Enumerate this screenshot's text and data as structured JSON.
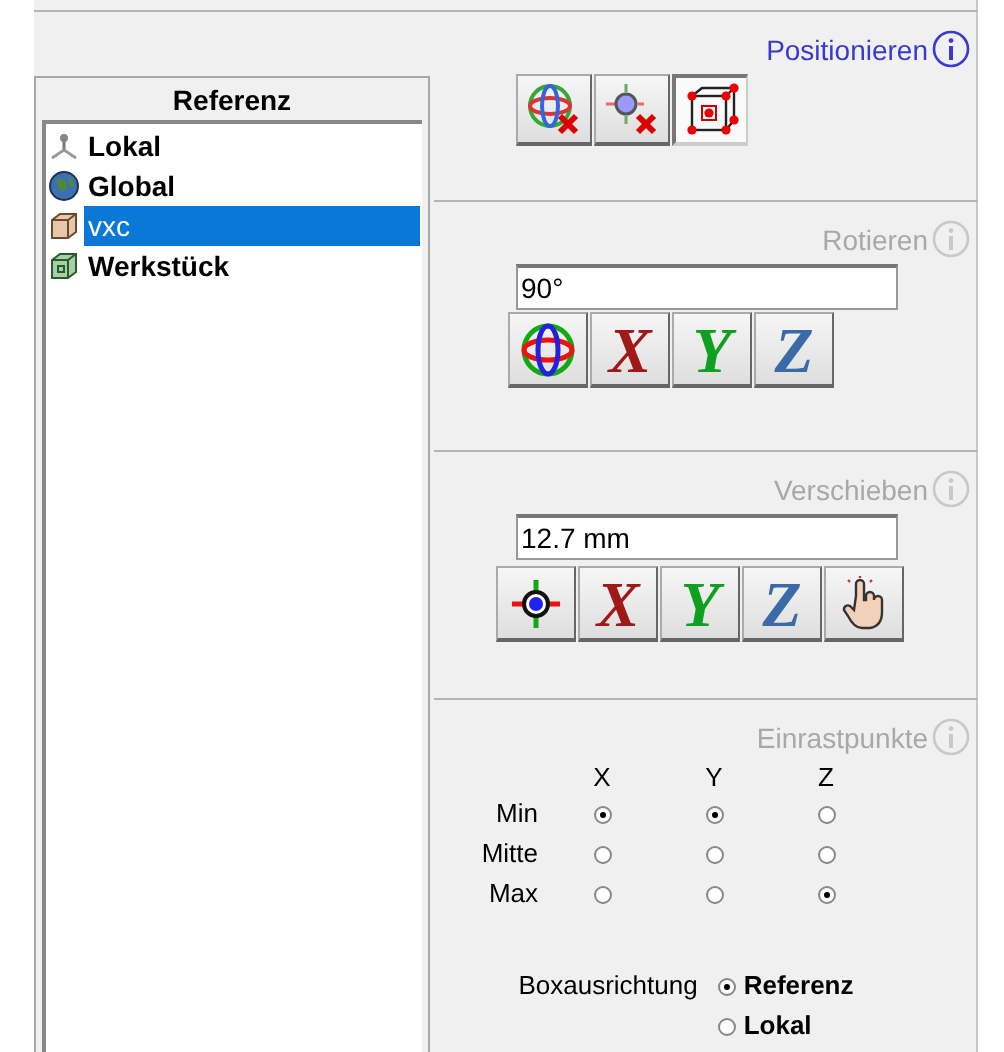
{
  "reference": {
    "title": "Referenz",
    "items": [
      {
        "label": "Lokal",
        "kind": "axes",
        "selected": false
      },
      {
        "label": "Global",
        "kind": "globe",
        "selected": false
      },
      {
        "label": "vxc",
        "kind": "box-tan",
        "selected": true
      },
      {
        "label": "Werkstück",
        "kind": "box-green",
        "selected": false
      }
    ]
  },
  "positioning": {
    "title": "Positionieren",
    "active": true,
    "buttons": [
      {
        "kind": "globe-remove",
        "selected": false
      },
      {
        "kind": "point-remove",
        "selected": false
      },
      {
        "kind": "bounding-box",
        "selected": true
      }
    ]
  },
  "rotate": {
    "title": "Rotieren",
    "active": false,
    "value": "90°",
    "buttons": [
      {
        "kind": "globe"
      },
      {
        "kind": "letter",
        "label": "X",
        "color": "#a01818"
      },
      {
        "kind": "letter",
        "label": "Y",
        "color": "#10a020"
      },
      {
        "kind": "letter",
        "label": "Z",
        "color": "#3a6aa8"
      }
    ]
  },
  "move": {
    "title": "Verschieben",
    "active": false,
    "value": "12.7 mm",
    "buttons": [
      {
        "kind": "crosshair"
      },
      {
        "kind": "letter",
        "label": "X",
        "color": "#a01818"
      },
      {
        "kind": "letter",
        "label": "Y",
        "color": "#10a020"
      },
      {
        "kind": "letter",
        "label": "Z",
        "color": "#3a6aa8"
      },
      {
        "kind": "hand"
      }
    ]
  },
  "snap_points": {
    "title": "Einrastpunkte",
    "active": false,
    "columns": [
      "X",
      "Y",
      "Z"
    ],
    "rows": [
      {
        "label": "Min",
        "options": [
          {
            "selected": true
          },
          {
            "selected": true
          },
          {
            "selected": false
          }
        ]
      },
      {
        "label": "Mitte",
        "options": [
          {
            "selected": false
          },
          {
            "selected": false
          },
          {
            "selected": false
          }
        ]
      },
      {
        "label": "Max",
        "options": [
          {
            "selected": false
          },
          {
            "selected": false
          },
          {
            "selected": true
          }
        ]
      }
    ],
    "box_alignment": {
      "label": "Boxausrichtung",
      "options": [
        {
          "label": "Referenz",
          "selected": true
        },
        {
          "label": "Lokal",
          "selected": false
        }
      ]
    }
  }
}
